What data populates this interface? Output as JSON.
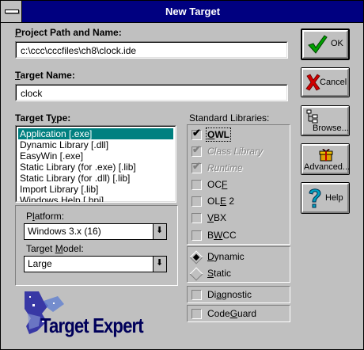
{
  "window": {
    "title": "New Target"
  },
  "project_path": {
    "label_pre": "P",
    "label_rest": "roject Path and Name:",
    "value": "c:\\ccc\\cccfiles\\ch8\\clock.ide"
  },
  "target_name": {
    "label_pre": "T",
    "label_rest": "arget Name:",
    "value": "clock"
  },
  "target_type": {
    "label_pre": "Target T",
    "label_u": "y",
    "label_rest": "pe:",
    "items": [
      "Application [.exe]",
      "Dynamic Library [.dll]",
      "EasyWin [.exe]",
      "Static Library (for .exe) [.lib]",
      "Static Library (for .dll) [.lib]",
      "Import Library [.lib]",
      "Windows Help [.hpj]"
    ],
    "selected": "Application [.exe]"
  },
  "platform": {
    "label_pre": "P",
    "label_u": "l",
    "label_rest": "atform:",
    "value": "Windows 3.x (16)"
  },
  "target_model": {
    "label_pre": "Target ",
    "label_u": "M",
    "label_rest": "odel:",
    "value": "Large"
  },
  "standard_libraries": {
    "label": "Standard Libraries:",
    "options": [
      {
        "pre": "",
        "u": "O",
        "rest": "WL",
        "checked": true,
        "enabled": true
      },
      {
        "pre": "Class Library",
        "u": "",
        "rest": "",
        "checked": true,
        "enabled": false
      },
      {
        "pre": "Runtime",
        "u": "",
        "rest": "",
        "checked": true,
        "enabled": false
      },
      {
        "pre": "OC",
        "u": "F",
        "rest": "",
        "checked": false,
        "enabled": true
      },
      {
        "pre": "OL",
        "u": "E",
        "rest": " 2",
        "checked": false,
        "enabled": true
      },
      {
        "pre": "",
        "u": "V",
        "rest": "BX",
        "checked": false,
        "enabled": true
      },
      {
        "pre": "B",
        "u": "W",
        "rest": "CC",
        "checked": false,
        "enabled": true
      }
    ]
  },
  "linking": {
    "dynamic": {
      "pre": "",
      "u": "D",
      "rest": "ynamic",
      "selected": true
    },
    "static": {
      "pre": "",
      "u": "S",
      "rest": "tatic",
      "selected": false
    }
  },
  "diagnostic": {
    "pre": "Di",
    "u": "a",
    "rest": "gnostic",
    "checked": false
  },
  "codeguard": {
    "pre": "Code",
    "u": "G",
    "rest": "uard",
    "checked": false
  },
  "buttons": {
    "ok": "OK",
    "cancel": "Cancel",
    "browse": "Browse...",
    "advanced": "Advanced...",
    "help": "Help"
  },
  "logo": {
    "text": "Target Expert"
  },
  "glyphs": {
    "check": "✔",
    "dropdown": "⬇"
  },
  "colors": {
    "title_bar": "#000080",
    "selection": "#008080",
    "logo_text": "#00005a"
  }
}
